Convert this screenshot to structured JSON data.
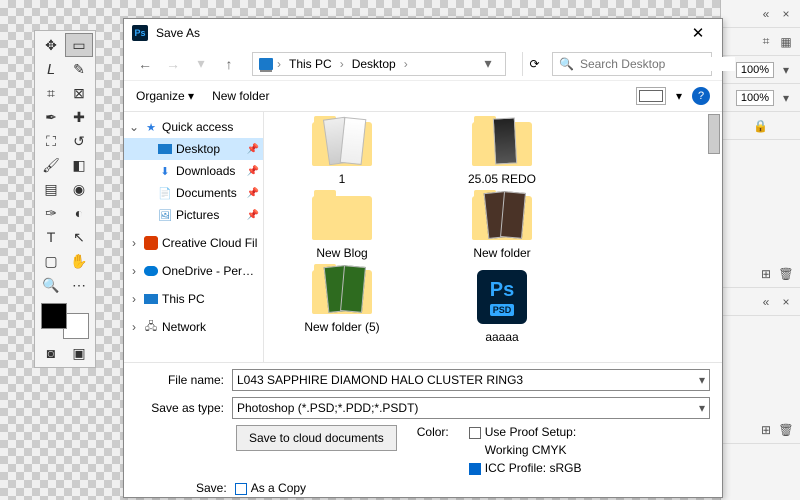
{
  "dialog": {
    "title": "Save As",
    "breadcrumb": [
      "This PC",
      "Desktop"
    ],
    "search_placeholder": "Search Desktop",
    "organize": "Organize",
    "new_folder": "New folder",
    "filename_label": "File name:",
    "filename_value": "L043 SAPPHIRE DIAMOND HALO CLUSTER RING3",
    "type_label": "Save as type:",
    "type_value": "Photoshop (*.PSD;*.PDD;*.PSDT)",
    "save_cloud": "Save to cloud documents",
    "save_label": "Save:",
    "as_a_copy": "As a Copy",
    "color_label": "Color:",
    "proof": "Use Proof Setup:",
    "proof2": "Working CMYK",
    "icc": "ICC Profile:  sRGB"
  },
  "tree": [
    {
      "label": "Quick access",
      "icon": "star",
      "exp": "v",
      "pin": false
    },
    {
      "label": "Desktop",
      "icon": "monitor",
      "exp": "",
      "pin": true,
      "sel": true,
      "indent": 1
    },
    {
      "label": "Downloads",
      "icon": "dl",
      "exp": "",
      "pin": true,
      "indent": 1
    },
    {
      "label": "Documents",
      "icon": "doc",
      "exp": "",
      "pin": true,
      "indent": 1
    },
    {
      "label": "Pictures",
      "icon": "pic",
      "exp": "",
      "pin": true,
      "indent": 1
    },
    {
      "label": "Creative Cloud Fil",
      "icon": "cc",
      "exp": ">",
      "pin": false
    },
    {
      "label": "OneDrive - Person",
      "icon": "cloud",
      "exp": ">",
      "pin": false
    },
    {
      "label": "This PC",
      "icon": "monitor",
      "exp": ">",
      "pin": false
    },
    {
      "label": "Network",
      "icon": "net",
      "exp": ">",
      "pin": false
    }
  ],
  "files": [
    {
      "label": "1",
      "kind": "folder-thumbs"
    },
    {
      "label": "25.05 REDO",
      "kind": "folder-bw"
    },
    {
      "label": "New Blog",
      "kind": "folder"
    },
    {
      "label": "New folder",
      "kind": "folder-brown"
    },
    {
      "label": "New folder (5)",
      "kind": "folder-green"
    },
    {
      "label": "ааааа",
      "kind": "psd"
    }
  ],
  "right": {
    "pct1": "100%",
    "pct2": "100%"
  }
}
